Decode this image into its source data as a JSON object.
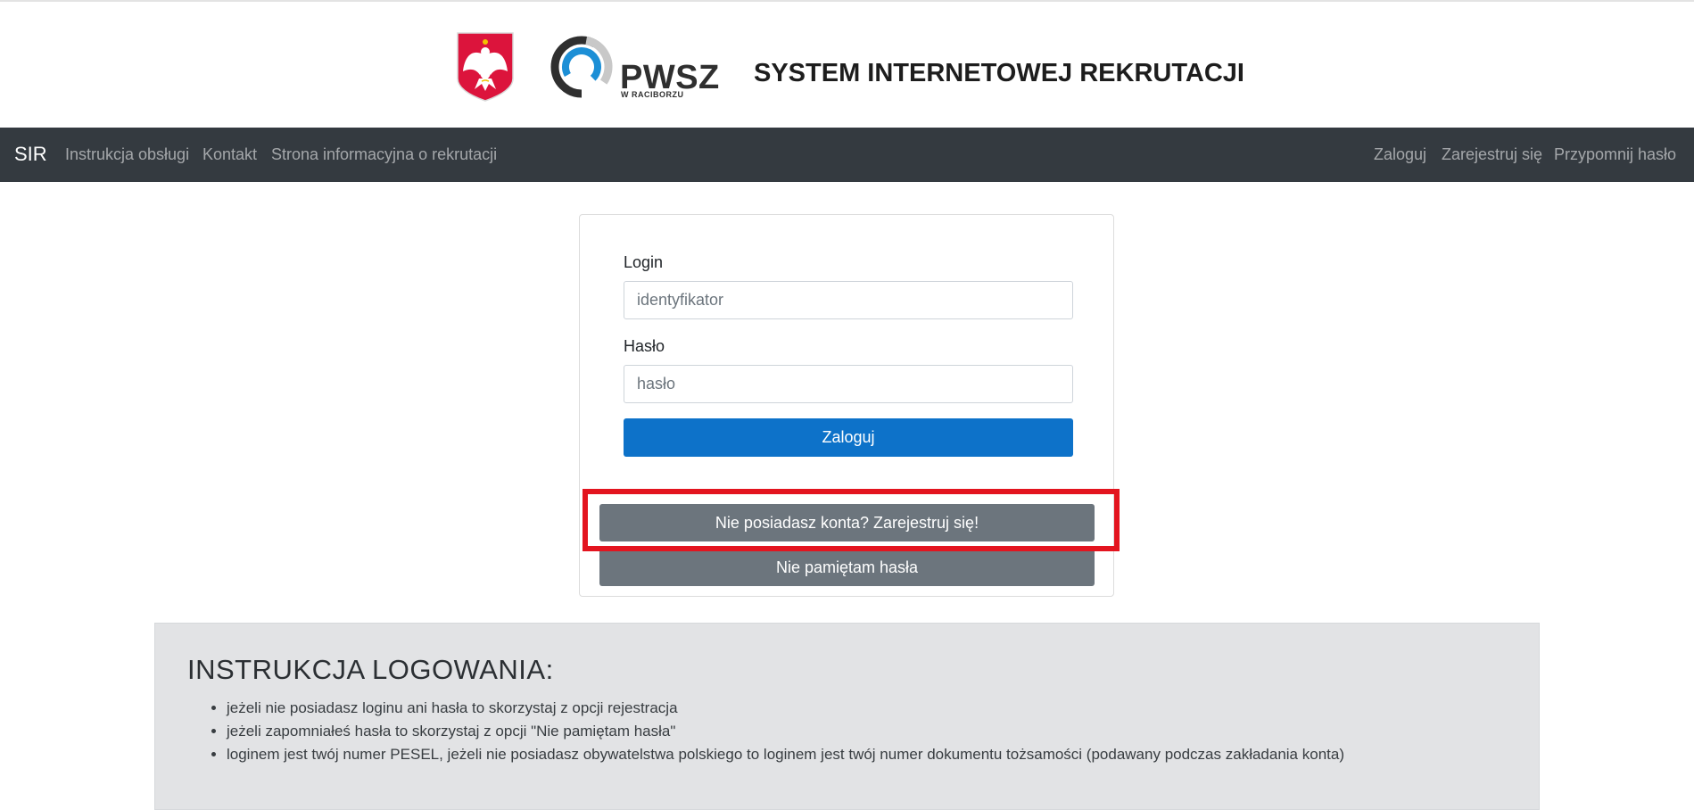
{
  "header": {
    "logo_text": "PWSZ",
    "logo_subtext": "W RACIBORZU",
    "title": "SYSTEM INTERNETOWEJ REKRUTACJI"
  },
  "navbar": {
    "brand": "SIR",
    "left_links": [
      "Instrukcja obsługi",
      "Kontakt",
      "Strona informacyjna o rekrutacji"
    ],
    "right_links": [
      "Zaloguj",
      "Zarejestruj się",
      "Przypomnij hasło"
    ]
  },
  "login_form": {
    "login_label": "Login",
    "login_placeholder": "identyfikator",
    "login_value": "",
    "password_label": "Hasło",
    "password_placeholder": "hasło",
    "password_value": "",
    "submit_label": "Zaloguj",
    "register_label": "Nie posiadasz konta? Zarejestruj się!",
    "forgot_label": "Nie pamiętam hasła"
  },
  "instructions": {
    "title": "INSTRUKCJA LOGOWANIA:",
    "items": [
      "jeżeli nie posiadasz loginu ani hasła to skorzystaj z opcji rejestracja",
      "jeżeli zapomniałeś hasła to skorzystaj z opcji \"Nie pamiętam hasła\"",
      "loginem jest twój numer PESEL, jeżeli nie posiadasz obywatelstwa polskiego to loginem jest twój numer dokumentu tożsamości (podawany podczas zakładania konta)"
    ]
  },
  "colors": {
    "navbar": "#343a40",
    "primary_button": "#0d72c9",
    "secondary_button": "#6c757d",
    "highlight_box": "#e3141f",
    "instructions_bg": "#e2e3e5"
  },
  "icons": [
    "polish-eagle-emblem-icon",
    "pwsz-logo-icon"
  ]
}
